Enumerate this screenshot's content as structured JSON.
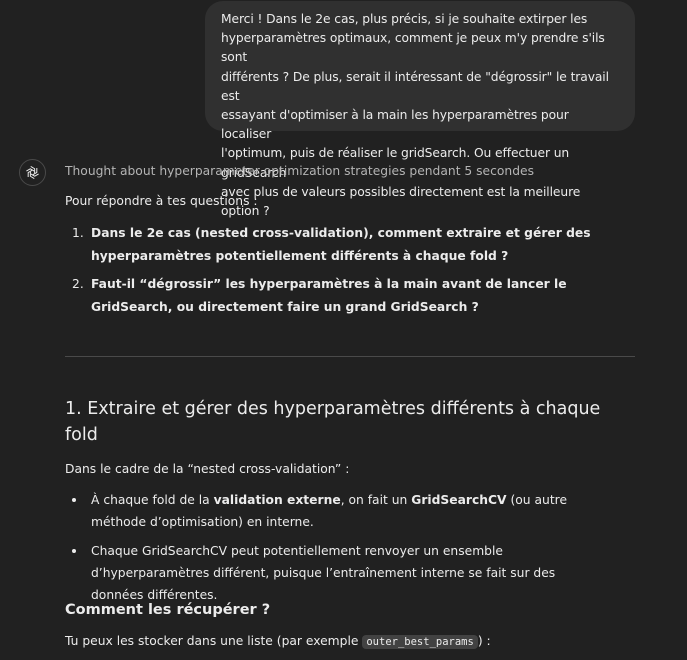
{
  "user_message": {
    "text": "Merci ! Dans le 2e cas, plus précis, si je souhaite extirper les\nhyperparamètres optimaux, comment je peux m'y prendre s'ils sont\ndifférents ? De plus, serait il intéressant de \"dégrossir\" le travail est\nessayant d'optimiser à la main les hyperparamètres pour localiser\nl'optimum, puis de réaliser le gridSearch. Ou effectuer un gridSearch\navec plus de valeurs possibles directement est la meilleure option ?"
  },
  "assistant": {
    "avatar_icon": "openai-logo-icon",
    "thought_label": "Thought about hyperparameter optimization strategies pendant 5 secondes",
    "intro": "Pour répondre à tes questions :",
    "questions": [
      {
        "num": "1.",
        "text": "Dans le 2e cas (nested cross-validation), comment extraire et gérer des hyperparamètres potentiellement différents à chaque fold ?"
      },
      {
        "num": "2.",
        "text": "Faut-il “dégrossir” les hyperparamètres à la main avant de lancer le GridSearch, ou directement faire un grand GridSearch ?"
      }
    ],
    "section1_title": "1. Extraire et gérer des hyperparamètres différents à chaque fold",
    "section1_context": "Dans le cadre de la “nested cross-validation” :",
    "bullets": [
      {
        "a": "À chaque fold de la ",
        "b": "validation externe",
        "c": ", on fait un ",
        "d": "GridSearchCV",
        "e": " (ou autre méthode d’optimisation) en interne."
      },
      {
        "text": "Chaque GridSearchCV peut potentiellement renvoyer un ensemble d’hyperparamètres différent, puisque l’entraînement interne se fait sur des données différentes."
      }
    ],
    "subsection_title": "Comment les récupérer ?",
    "store_prefix": "Tu peux les stocker dans une liste (par exemple ",
    "store_code": "outer_best_params",
    "store_suffix": ") :"
  },
  "colors": {
    "background": "#212121",
    "user_bubble": "#303030",
    "text": "#ececec",
    "muted_text": "#b4b4b4",
    "divider": "#4a4a4a",
    "code_bg": "#424242"
  }
}
